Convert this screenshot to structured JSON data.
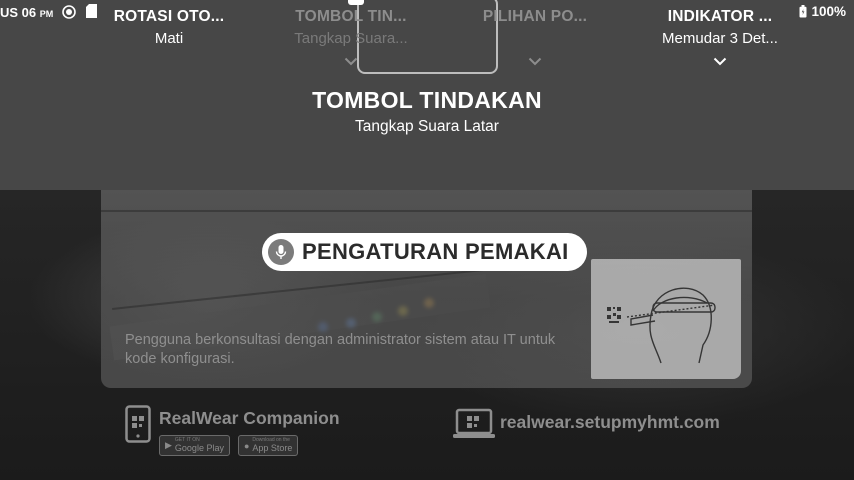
{
  "status_bar": {
    "time": "US 06",
    "ampm": "PM",
    "battery": "100%"
  },
  "options": [
    {
      "title": "ROTASI OTO...",
      "value": "Mati"
    },
    {
      "title": "TOMBOL TIN...",
      "value": "Tangkap Suara..."
    },
    {
      "title": "PILIHAN PO...",
      "value": ""
    },
    {
      "title": "INDIKATOR ...",
      "value": "Memudar 3 Det..."
    }
  ],
  "selected": {
    "title": "TOMBOL TINDAKAN",
    "subtitle": "Tangkap Suara Latar"
  },
  "card": {
    "title": "PENGATURAN PEMAKAI",
    "description": "Pengguna berkonsultasi dengan administrator sistem atau IT untuk kode konfigurasi."
  },
  "footer": {
    "companion_label": "RealWear Companion",
    "google_play_small": "GET IT ON",
    "google_play": "Google Play",
    "app_store_small": "Download on the",
    "app_store": "App Store",
    "website": "realwear.setupmyhmt.com"
  },
  "colors": {
    "panel": "#474747",
    "pill": "#ffffff",
    "dim_text": "#8d8d8d"
  },
  "icons": [
    "location-icon",
    "sd-card-icon",
    "battery-icon",
    "chevron-down-icon",
    "microphone-icon",
    "phone-qr-icon",
    "laptop-qr-icon",
    "headset-illustration"
  ]
}
